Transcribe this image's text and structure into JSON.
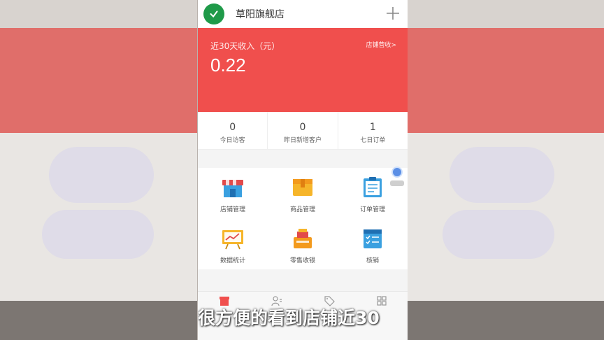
{
  "header": {
    "store_name": "草阳旗舰店",
    "avatar_icon": "leaf-check-icon",
    "add_icon": "plus-icon"
  },
  "banner": {
    "income_label": "近30天收入（元）",
    "income_value": "0.22",
    "store_income_link": "店铺营收>",
    "color": "#f04f4d"
  },
  "stats": [
    {
      "value": "0",
      "label": "今日访客"
    },
    {
      "value": "0",
      "label": "昨日新增客户"
    },
    {
      "value": "1",
      "label": "七日订单"
    }
  ],
  "menu": [
    {
      "label": "店铺管理",
      "icon": "storefront-icon"
    },
    {
      "label": "商品管理",
      "icon": "product-box-icon"
    },
    {
      "label": "订单管理",
      "icon": "order-clipboard-icon"
    },
    {
      "label": "数据统计",
      "icon": "chart-board-icon"
    },
    {
      "label": "零售收银",
      "icon": "cash-register-icon"
    },
    {
      "label": "核销",
      "icon": "checklist-icon"
    }
  ],
  "tabbar": [
    {
      "icon": "home-store-icon"
    },
    {
      "icon": "customers-icon"
    },
    {
      "icon": "tag-icon"
    },
    {
      "icon": "apps-grid-icon"
    }
  ],
  "subtitle": "很方便的看到店铺近30"
}
